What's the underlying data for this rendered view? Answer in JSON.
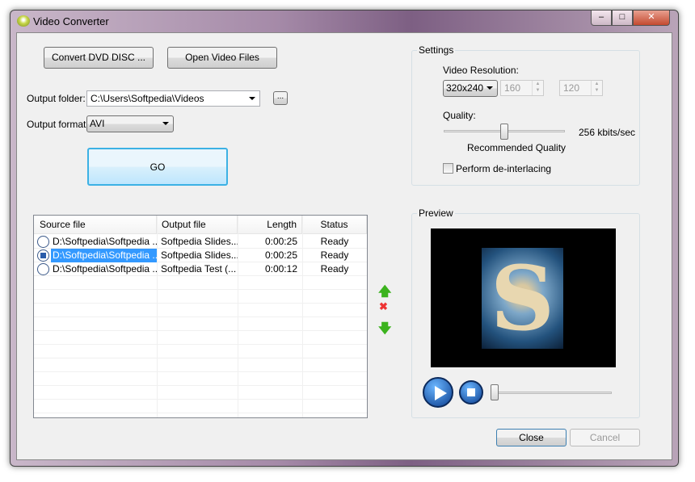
{
  "window": {
    "title": "Video Converter",
    "minimize": "–",
    "maximize": "□",
    "close": "✕"
  },
  "toolbar": {
    "convert_dvd": "Convert DVD DISC ...",
    "open_files": "Open Video Files"
  },
  "output": {
    "folder_label": "Output folder:",
    "folder_value": "C:\\Users\\Softpedia\\Videos",
    "browse": "...",
    "format_label": "Output format:",
    "format_value": "AVI"
  },
  "go": "GO",
  "settings": {
    "title": "Settings",
    "resolution_label": "Video Resolution:",
    "resolution_value": "320x240",
    "width": "160",
    "height": "120",
    "quality_label": "Quality:",
    "quality_value": "256 kbits/sec",
    "quality_hint": "Recommended Quality",
    "quality_fraction": 0.5,
    "deinterlace_label": "Perform de-interlacing",
    "deinterlace_checked": false
  },
  "table": {
    "columns": [
      "Source file",
      "Output file",
      "Length",
      "Status"
    ],
    "rows": [
      {
        "source": "D:\\Softpedia\\Softpedia ...",
        "output": "Softpedia Slides...",
        "length": "0:00:25",
        "status": "Ready",
        "selected": false
      },
      {
        "source": "D:\\Softpedia\\Softpedia ...",
        "output": "Softpedia Slides...",
        "length": "0:00:25",
        "status": "Ready",
        "selected": true
      },
      {
        "source": "D:\\Softpedia\\Softpedia ...",
        "output": "Softpedia Test (...",
        "length": "0:00:12",
        "status": "Ready",
        "selected": false
      }
    ]
  },
  "preview": {
    "title": "Preview",
    "position_fraction": 0
  },
  "footer": {
    "close": "Close",
    "cancel": "Cancel"
  },
  "colors": {
    "selection": "#3399ff",
    "accent": "#3c7fb1"
  }
}
